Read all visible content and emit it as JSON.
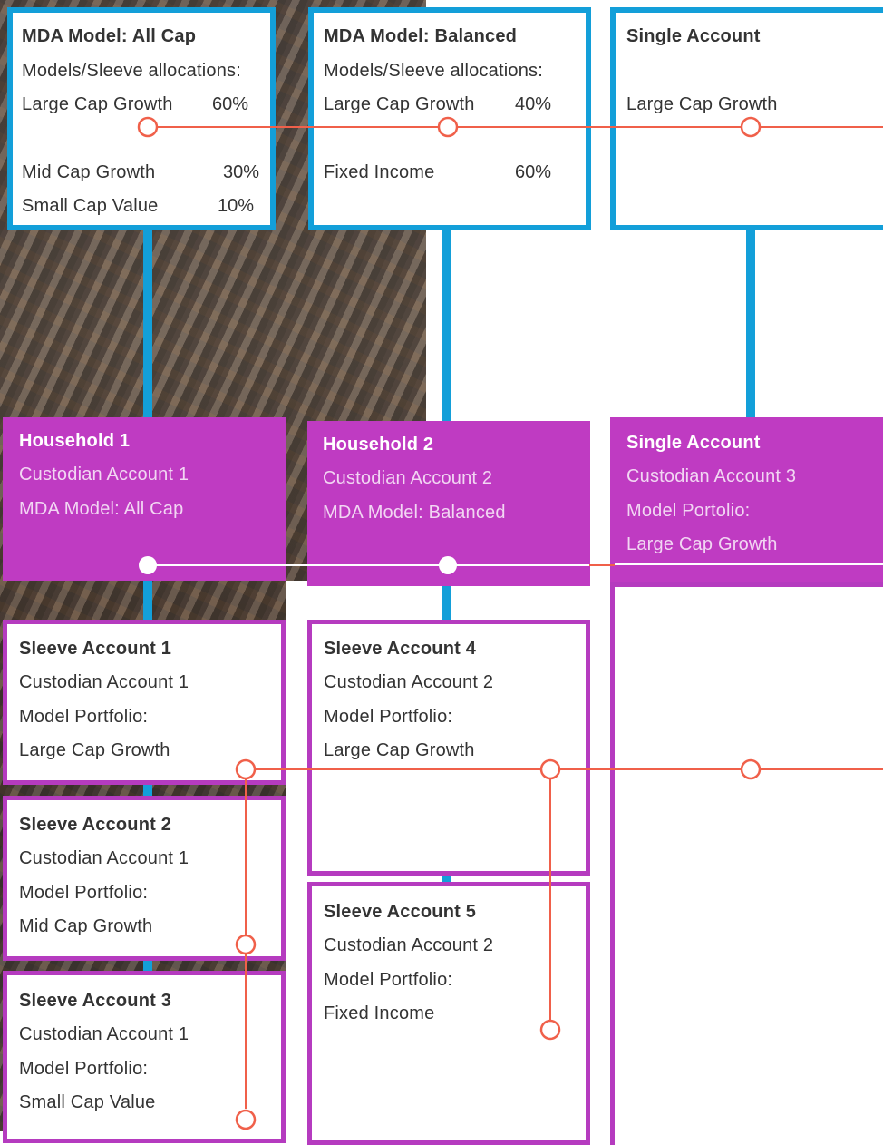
{
  "mda_models": [
    {
      "title": "MDA Model: All Cap",
      "subtitle": "Models/Sleeve allocations:",
      "rows": [
        {
          "label": "Large Cap Growth",
          "value": "60%"
        },
        {
          "label": "Mid Cap Growth",
          "value": "30%"
        },
        {
          "label": "Small Cap Value",
          "value": "10%"
        }
      ]
    },
    {
      "title": "MDA Model: Balanced",
      "subtitle": "Models/Sleeve allocations:",
      "rows": [
        {
          "label": "Large Cap Growth",
          "value": "40%"
        },
        {
          "label": "Fixed Income",
          "value": "60%"
        }
      ]
    },
    {
      "title": "Single Account",
      "rows": [
        {
          "label": "Large Cap Growth"
        }
      ]
    }
  ],
  "households": [
    {
      "title": "Household 1",
      "lines": [
        "Custodian Account 1",
        "MDA Model: All Cap"
      ]
    },
    {
      "title": "Household 2",
      "lines": [
        "Custodian Account 2",
        "MDA Model: Balanced"
      ]
    },
    {
      "title": "Single Account",
      "lines": [
        "Custodian Account 3",
        "Model Portolio:",
        "Large Cap Growth"
      ]
    }
  ],
  "sleeves": [
    {
      "title": "Sleeve Account 1",
      "lines": [
        "Custodian Account 1",
        "Model Portfolio:",
        "Large Cap Growth"
      ]
    },
    {
      "title": "Sleeve Account 2",
      "lines": [
        "Custodian Account 1",
        "Model Portfolio:",
        "Mid Cap Growth"
      ]
    },
    {
      "title": "Sleeve Account 3",
      "lines": [
        "Custodian Account 1",
        "Model Portfolio:",
        "Small Cap Value"
      ]
    },
    {
      "title": "Sleeve Account 4",
      "lines": [
        "Custodian Account 2",
        "Model Portfolio:",
        "Large Cap Growth"
      ]
    },
    {
      "title": "Sleeve Account 5",
      "lines": [
        "Custodian Account 2",
        "Model Portfolio:",
        "Fixed Income"
      ]
    }
  ],
  "colors": {
    "blue": "#139fd9",
    "magenta": "#bf3bc2",
    "orange": "#f0604a"
  }
}
